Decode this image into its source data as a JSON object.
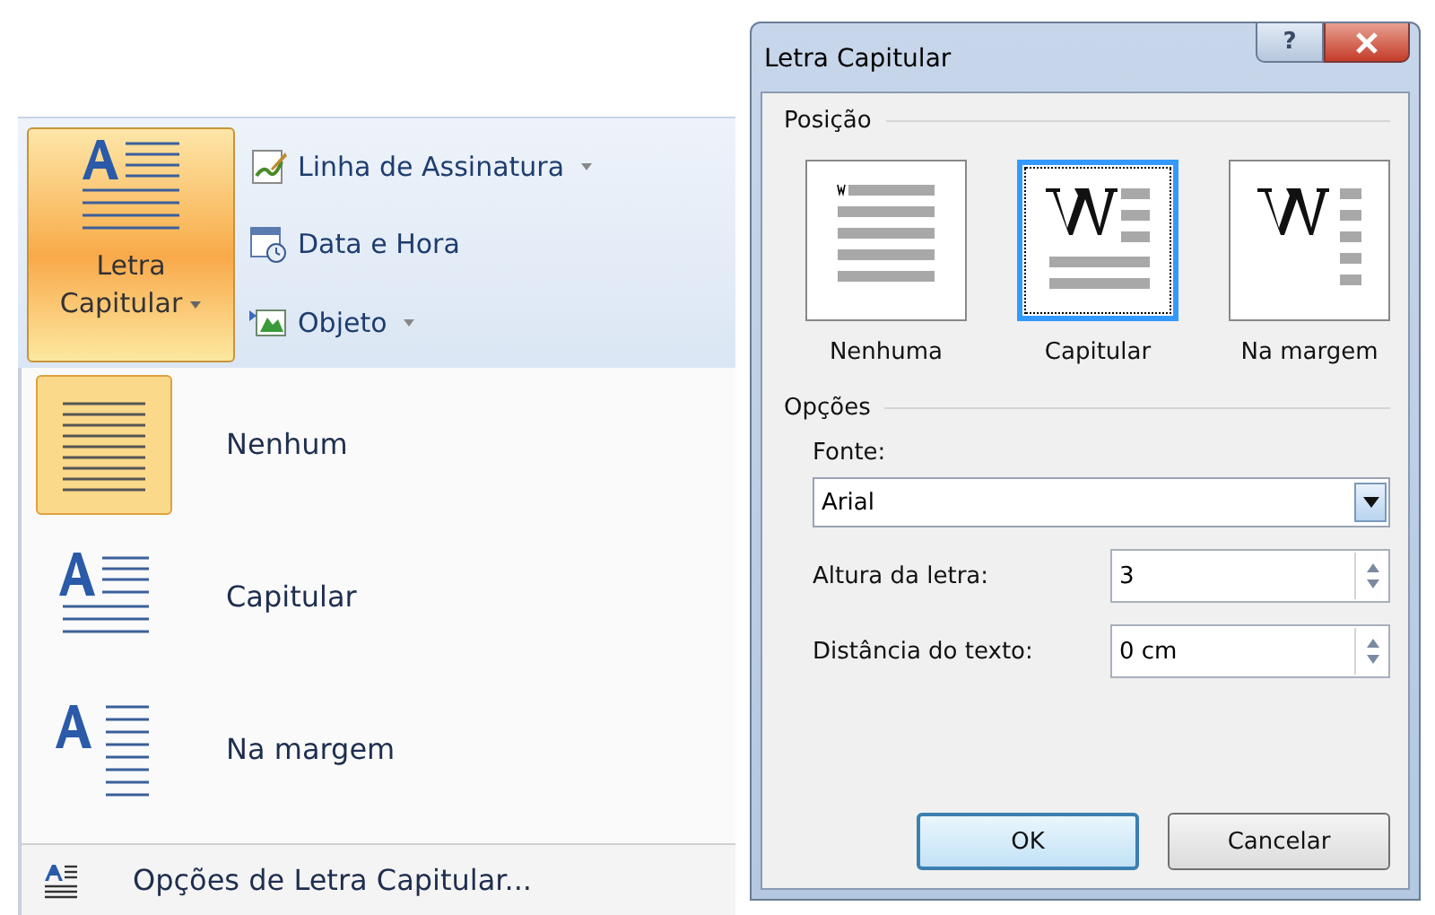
{
  "ribbon": {
    "main_button": {
      "label_lines": [
        "Letra",
        "Capitular"
      ],
      "active": true
    },
    "items": [
      {
        "label": "Linha de Assinatura",
        "kind": "signature",
        "dropdown": true
      },
      {
        "label": "Data e Hora",
        "kind": "datetime",
        "dropdown": false
      },
      {
        "label": "Objeto",
        "kind": "object",
        "dropdown": true
      }
    ]
  },
  "menu": {
    "items": [
      {
        "label": "Nenhum",
        "kind": "none",
        "selected": true
      },
      {
        "label": "Capitular",
        "kind": "dropped",
        "selected": false
      },
      {
        "label": "Na margem",
        "kind": "margin",
        "selected": false
      }
    ],
    "footer": "Opções de Letra Capitular..."
  },
  "dialog": {
    "title": "Letra Capitular",
    "help": "?",
    "position": {
      "heading": "Posição",
      "options": [
        {
          "label": "Nenhuma",
          "kind": "none",
          "selected": false
        },
        {
          "label": "Capitular",
          "kind": "dropped",
          "selected": true
        },
        {
          "label": "Na margem",
          "kind": "margin",
          "selected": false
        }
      ]
    },
    "options": {
      "heading": "Opções",
      "font_label": "Fonte:",
      "font_value": "Arial",
      "height_label": "Altura da letra:",
      "height_value": "3",
      "distance_label": "Distância do texto:",
      "distance_value": "0 cm"
    },
    "buttons": [
      {
        "label": "OK",
        "default": true
      },
      {
        "label": "Cancelar",
        "default": false
      }
    ]
  }
}
